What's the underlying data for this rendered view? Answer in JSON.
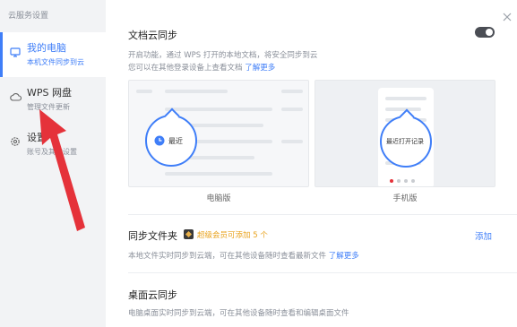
{
  "sidebar": {
    "title": "云服务设置",
    "items": [
      {
        "label": "我的电脑",
        "sub": "本机文件同步到云",
        "icon": "monitor-icon"
      },
      {
        "label": "WPS 网盘",
        "sub": "管理文件更新",
        "icon": "cloud-icon"
      },
      {
        "label": "设置",
        "sub": "账号及其他设置",
        "icon": "gear-icon"
      }
    ]
  },
  "doc_sync": {
    "title": "文档云同步",
    "desc1": "开启功能，通过 WPS 打开的本地文档，将安全同步到云",
    "desc2": "您可以在其他登录设备上查看文档",
    "learn_more": "了解更多",
    "toggle_state": "on"
  },
  "previews": {
    "pc": {
      "bubble_text": "最近",
      "label": "电脑版"
    },
    "mobile": {
      "bubble_text": "最近打开记录",
      "label": "手机版"
    }
  },
  "folder_sync": {
    "title": "同步文件夹",
    "vip_text": "超级会员可添加 5 个",
    "add": "添加",
    "desc": "本地文件实时同步到云端，可在其他设备随时查看最新文件",
    "learn_more": "了解更多"
  },
  "desktop_sync": {
    "title": "桌面云同步",
    "desc": "电脑桌面实时同步到云端，可在其他设备随时查看和编辑桌面文件"
  },
  "colors": {
    "accent": "#3f7ef8",
    "arrow": "#e5323a",
    "vip": "#e9a21c"
  }
}
